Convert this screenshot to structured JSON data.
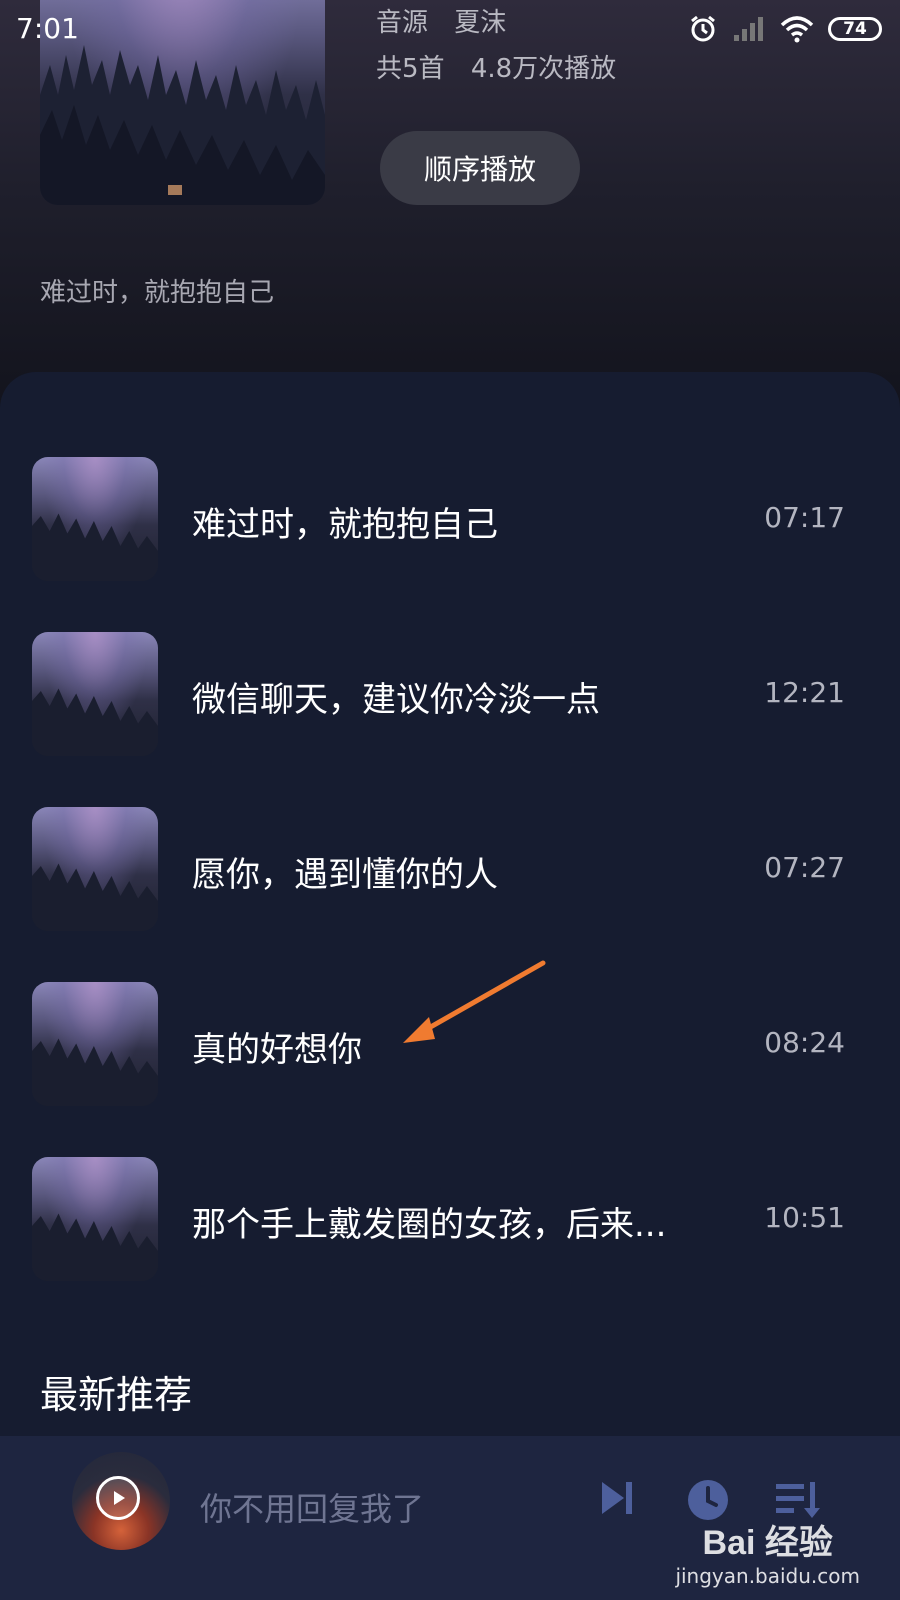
{
  "status_bar": {
    "time": "7:01",
    "battery": "74"
  },
  "album": {
    "source_label": "音源",
    "source_name": "夏沫",
    "count": "共5首",
    "plays": "4.8万次播放",
    "play_order_label": "顺序播放",
    "description": "难过时，就抱抱自己"
  },
  "tracks": [
    {
      "title": "难过时，就抱抱自己",
      "duration": "07:17"
    },
    {
      "title": "微信聊天，建议你冷淡一点",
      "duration": "12:21"
    },
    {
      "title": "愿你，遇到懂你的人",
      "duration": "07:27"
    },
    {
      "title": "真的好想你",
      "duration": "08:24"
    },
    {
      "title": "那个手上戴发圈的女孩，后来...",
      "duration": "10:51"
    }
  ],
  "section": {
    "latest_title": "最新推荐"
  },
  "mini_player": {
    "now_playing": "你不用回复我了"
  },
  "watermark": {
    "brand": "Bai 经验",
    "url": "jingyan.baidu.com"
  },
  "colors": {
    "background": "#161c30",
    "mini_player_bg": "#1e2540",
    "arrow": "#f07b30",
    "control_icon": "#4d5f9c"
  }
}
